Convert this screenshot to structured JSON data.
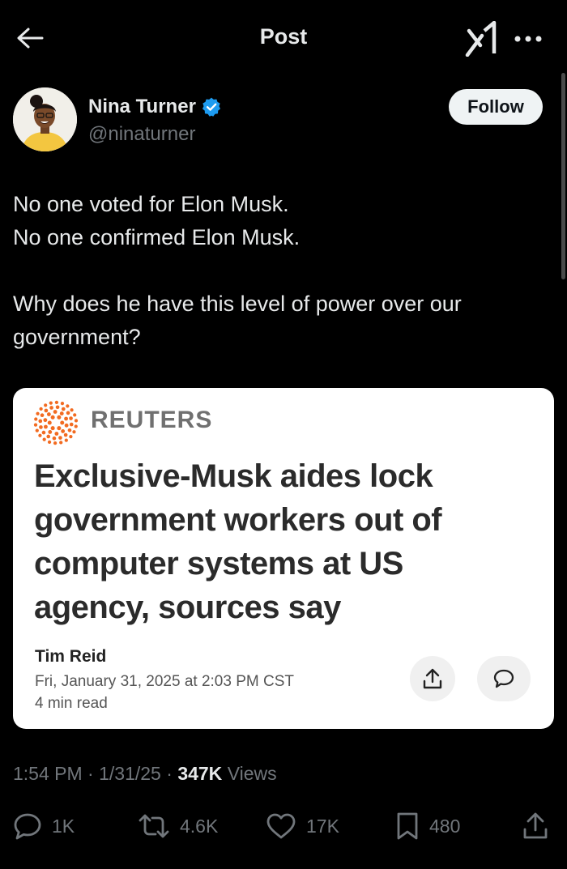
{
  "header": {
    "title": "Post"
  },
  "author": {
    "name": "Nina Turner",
    "handle": "@ninaturner",
    "verified": true,
    "follow_label": "Follow"
  },
  "post": {
    "lines": [
      "No one voted for Elon Musk.",
      "No one confirmed Elon Musk.",
      "",
      "Why does he have this level of power over our government?"
    ]
  },
  "card": {
    "source": "REUTERS",
    "headline": "Exclusive-Musk aides lock government workers out of computer systems at US agency, sources say",
    "byline": "Tim Reid",
    "date": "Fri, January 31, 2025 at 2:03 PM CST",
    "read_time": "4 min read"
  },
  "meta": {
    "time": "1:54 PM",
    "date": "1/31/25",
    "views_count": "347K",
    "views_label": "Views"
  },
  "actions": {
    "replies": "1K",
    "reposts": "4.6K",
    "likes": "17K",
    "bookmarks": "480"
  },
  "colors": {
    "background": "#000000",
    "primary_text": "#e7e9ea",
    "secondary_text": "#71767b",
    "verified_badge": "#1d9bf0",
    "reuters_orange": "#f26b21"
  },
  "icons": {
    "back": "arrow-left-icon",
    "grok": "grok-icon",
    "more": "more-dots-icon",
    "verified": "verified-badge-icon",
    "reply": "reply-icon",
    "repost": "repost-icon",
    "like": "heart-icon",
    "bookmark": "bookmark-icon",
    "share": "share-icon"
  }
}
